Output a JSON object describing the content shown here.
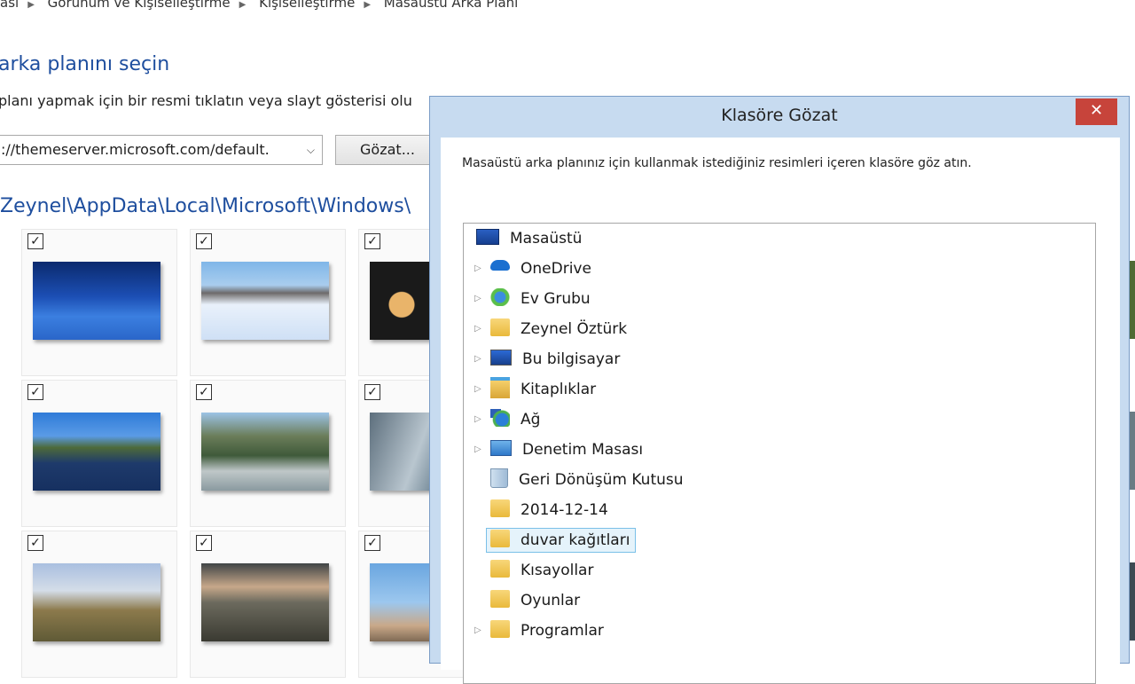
{
  "breadcrumb": [
    "ası",
    "Görünüm ve Kişiselleştirme",
    "Kişiselleştirme",
    "Masaüstü Arka Planı"
  ],
  "page": {
    "title": "arka planını seçin",
    "description": "planı yapmak için bir resmi tıklatın veya slayt gösterisi olu",
    "location_value": "://themeserver.microsoft.com/default.",
    "browse_label": "Gözat...",
    "folder_path": "Zeynel\\AppData\\Local\\Microsoft\\Windows\\"
  },
  "wallpapers": [
    {
      "checked": true,
      "check_mark": "✓"
    },
    {
      "checked": true,
      "check_mark": "✓"
    },
    {
      "checked": true,
      "check_mark": "✓"
    },
    {
      "checked": true,
      "check_mark": "✓"
    },
    {
      "checked": true,
      "check_mark": "✓"
    },
    {
      "checked": true,
      "check_mark": "✓"
    },
    {
      "checked": true,
      "check_mark": "✓"
    },
    {
      "checked": true,
      "check_mark": "✓"
    },
    {
      "checked": true,
      "check_mark": "✓"
    }
  ],
  "dialog": {
    "title": "Klasöre Gözat",
    "close_glyph": "✕",
    "instruction": "Masaüstü arka planınız için kullanmak istediğiniz resimleri içeren klasöre göz atın.",
    "tree": [
      {
        "label": "Masaüstü",
        "icon": "desktop-icon",
        "expandable": false
      },
      {
        "label": "OneDrive",
        "icon": "onedrive-icon",
        "expandable": true
      },
      {
        "label": "Ev Grubu",
        "icon": "homegroup-icon",
        "expandable": true
      },
      {
        "label": "Zeynel Öztürk",
        "icon": "user-folder-icon",
        "expandable": true
      },
      {
        "label": "Bu bilgisayar",
        "icon": "computer-icon",
        "expandable": true
      },
      {
        "label": "Kitaplıklar",
        "icon": "libraries-icon",
        "expandable": true
      },
      {
        "label": "Ağ",
        "icon": "network-icon",
        "expandable": true
      },
      {
        "label": "Denetim Masası",
        "icon": "control-panel-icon",
        "expandable": true
      },
      {
        "label": "Geri Dönüşüm Kutusu",
        "icon": "recycle-bin-icon",
        "expandable": false
      },
      {
        "label": "2014-12-14",
        "icon": "folder-icon",
        "expandable": false
      },
      {
        "label": "duvar kağıtları",
        "icon": "folder-icon",
        "expandable": false,
        "selected": true
      },
      {
        "label": "Kısayollar",
        "icon": "folder-icon",
        "expandable": false
      },
      {
        "label": "Oyunlar",
        "icon": "folder-icon",
        "expandable": false
      },
      {
        "label": "Programlar",
        "icon": "folder-icon",
        "expandable": true
      }
    ],
    "tree_arrow": "▷"
  },
  "colors": {
    "accent": "#1e4e9e",
    "dialog_frame": "#c7dbf0",
    "close": "#c7443b",
    "selection": "#e5f3fb"
  }
}
